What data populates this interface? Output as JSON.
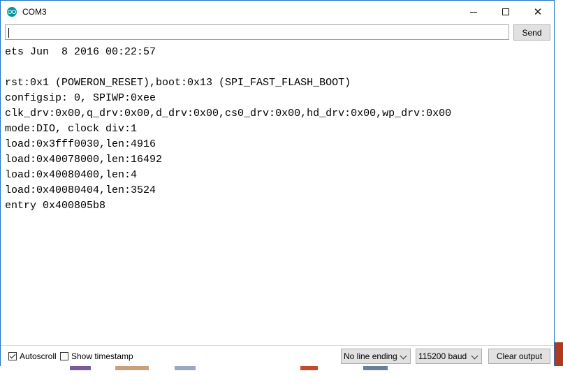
{
  "window": {
    "title": "COM3",
    "minimize_glyph": "",
    "close_glyph": "✕"
  },
  "send_row": {
    "input_value": "",
    "send_label": "Send"
  },
  "console": {
    "lines": [
      "ets Jun  8 2016 00:22:57",
      "",
      "rst:0x1 (POWERON_RESET),boot:0x13 (SPI_FAST_FLASH_BOOT)",
      "configsip: 0, SPIWP:0xee",
      "clk_drv:0x00,q_drv:0x00,d_drv:0x00,cs0_drv:0x00,hd_drv:0x00,wp_drv:0x00",
      "mode:DIO, clock div:1",
      "load:0x3fff0030,len:4916",
      "load:0x40078000,len:16492",
      "load:0x40080400,len:4",
      "load:0x40080404,len:3524",
      "entry 0x400805b8"
    ]
  },
  "bottom_bar": {
    "autoscroll_label": "Autoscroll",
    "autoscroll_checked": true,
    "timestamp_label": "Show timestamp",
    "timestamp_checked": false,
    "line_ending_value": "No line ending",
    "baud_value": "115200 baud",
    "clear_label": "Clear output"
  },
  "colors": {
    "accent": "#00979c",
    "window_border": "#1a73c7",
    "button_face": "#e1e1e1"
  }
}
